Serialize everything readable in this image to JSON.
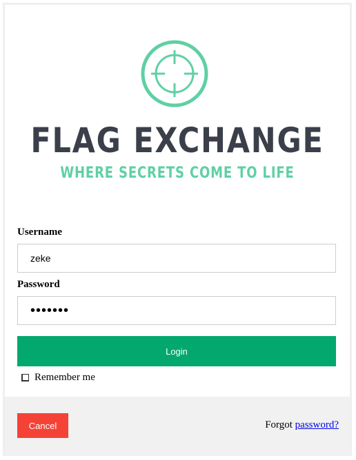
{
  "brand": {
    "title": "FLAG EXCHANGE",
    "tagline": "WHERE SECRETS COME TO LIFE",
    "logo_icon": "crosshair-target-icon",
    "title_color": "#3a3f4a",
    "accent_color": "#5fd0a4"
  },
  "form": {
    "username_label": "Username",
    "username_value": "zeke",
    "password_label": "Password",
    "password_masked": "•••••••",
    "login_label": "Login",
    "remember_label": "Remember me"
  },
  "footer": {
    "cancel_label": "Cancel",
    "forgot_prefix": "Forgot",
    "forgot_link": "password?"
  },
  "colors": {
    "login_button": "#03a86e",
    "cancel_button": "#f44336",
    "footer_bg": "#f1f1f1",
    "link": "#0000ee"
  }
}
